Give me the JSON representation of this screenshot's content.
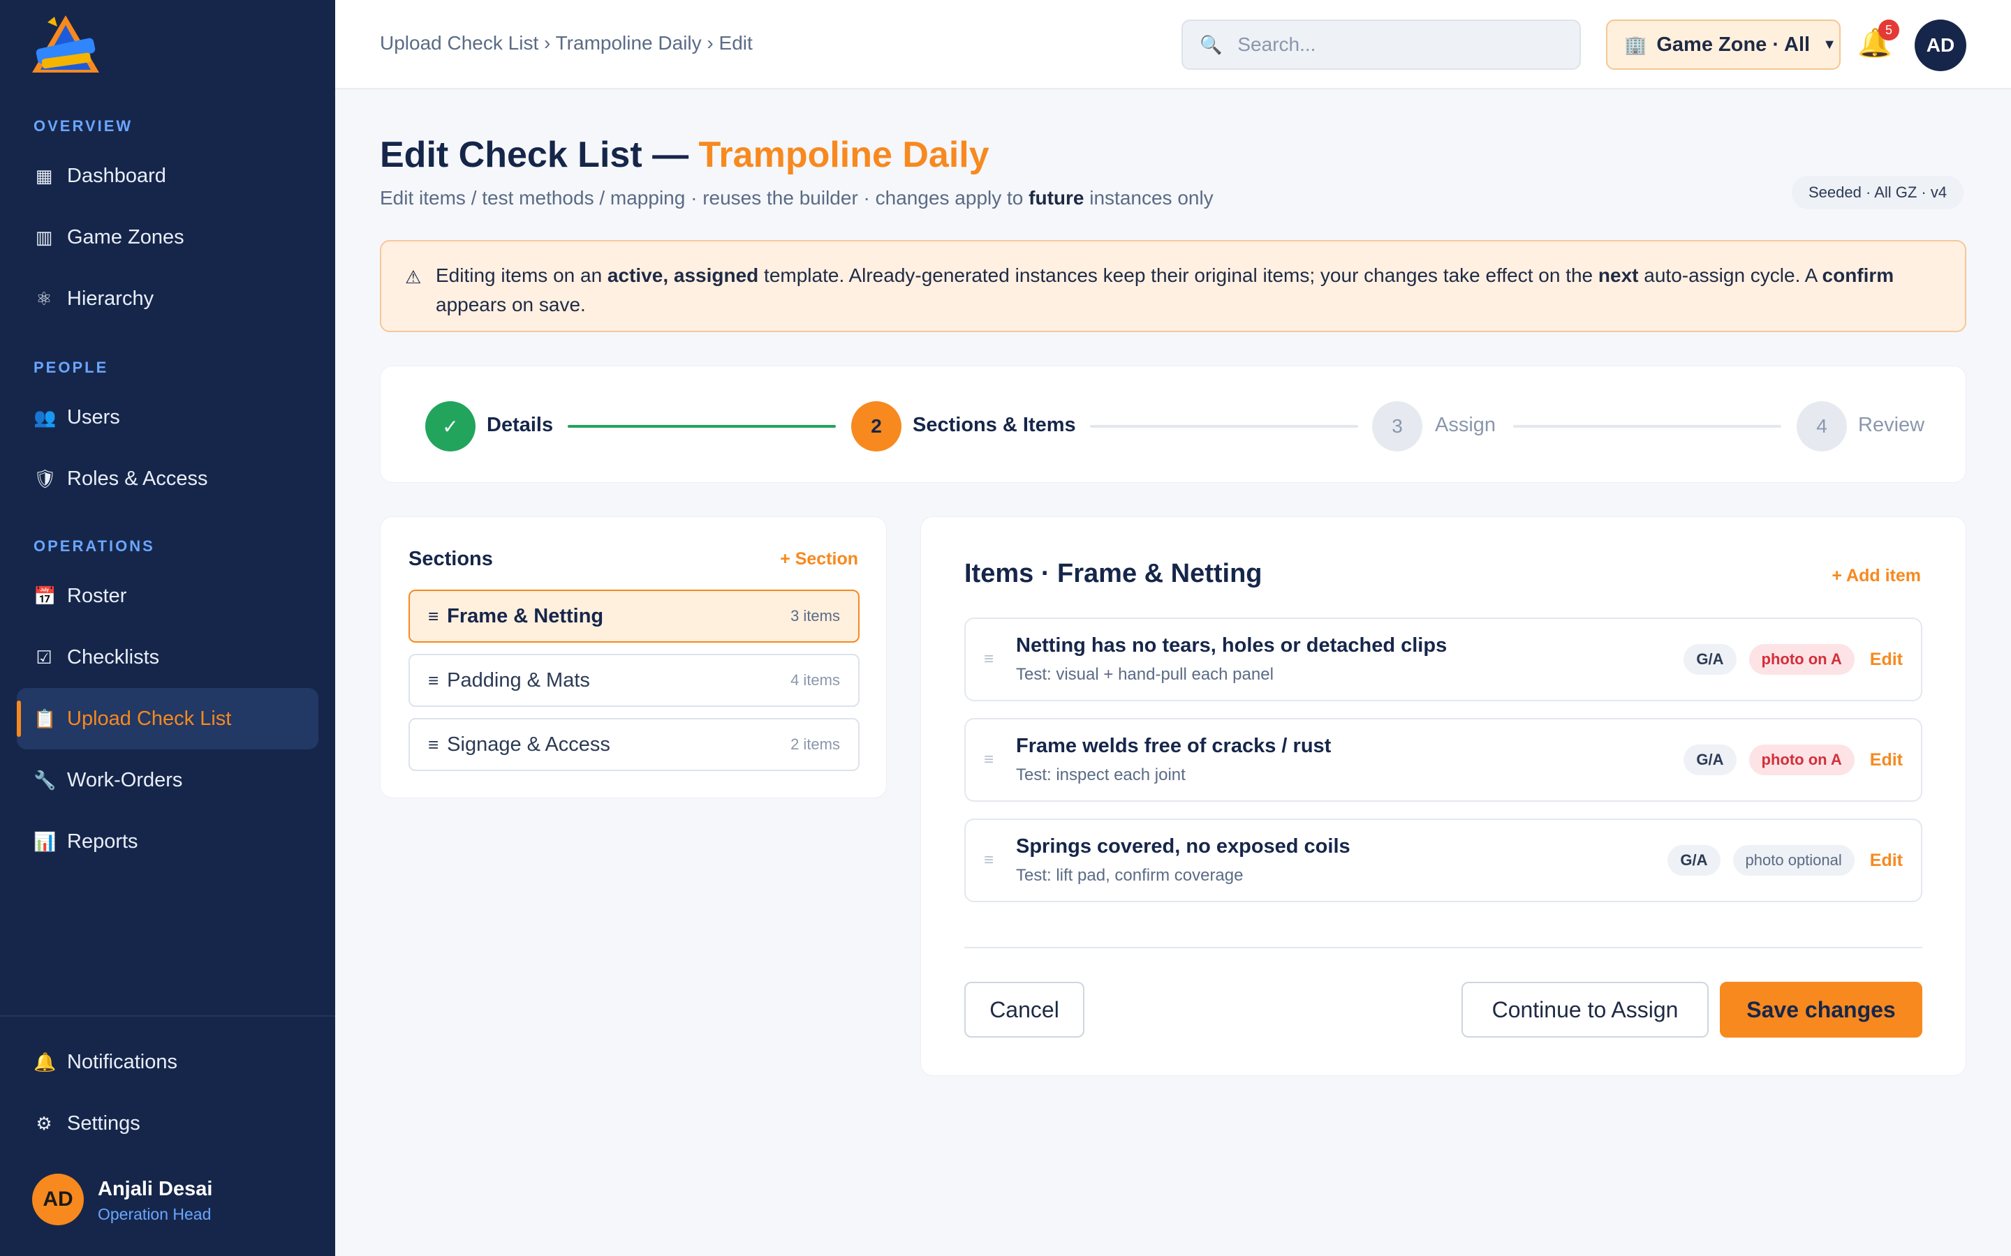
{
  "sidebar": {
    "groups": [
      {
        "title": "OVERVIEW",
        "items": [
          {
            "label": "Dashboard",
            "icon": "dashboard-icon"
          },
          {
            "label": "Game Zones",
            "icon": "building-icon"
          },
          {
            "label": "Hierarchy",
            "icon": "hierarchy-icon"
          }
        ]
      },
      {
        "title": "PEOPLE",
        "items": [
          {
            "label": "Users",
            "icon": "users-icon"
          },
          {
            "label": "Roles & Access",
            "icon": "shield-icon"
          }
        ]
      },
      {
        "title": "OPERATIONS",
        "items": [
          {
            "label": "Roster",
            "icon": "calendar-icon"
          },
          {
            "label": "Checklists",
            "icon": "checkbox-icon"
          },
          {
            "label": "Upload Check List",
            "icon": "clipboard-icon",
            "active": true
          },
          {
            "label": "Work-Orders",
            "icon": "wrench-icon"
          },
          {
            "label": "Reports",
            "icon": "bar-chart-icon"
          }
        ]
      }
    ],
    "bottom": [
      {
        "label": "Notifications",
        "icon": "bell-icon"
      },
      {
        "label": "Settings",
        "icon": "gear-icon"
      }
    ],
    "user": {
      "initials": "AD",
      "name": "Anjali Desai",
      "role": "Operation Head"
    }
  },
  "topbar": {
    "breadcrumb": "Upload Check List › Trampoline Daily › Edit",
    "search_placeholder": "Search...",
    "zone_selector": "Game Zone · All",
    "notification_count": "5",
    "avatar_initials": "AD"
  },
  "header": {
    "title_prefix": "Edit Check List — ",
    "title_accent": "Trampoline Daily",
    "subtitle_before": "Edit items / test methods / mapping · reuses the builder · changes apply to ",
    "subtitle_bold": "future",
    "subtitle_after": " instances only",
    "version_pill": "Seeded · All GZ · v4"
  },
  "warning": {
    "t1": "Editing items on an ",
    "b1": "active, assigned",
    "t2": " template. Already-generated instances keep their original items; your changes take effect on the ",
    "b2": "next",
    "t3": " auto-assign cycle. A ",
    "b3": "confirm",
    "t4": " appears on save."
  },
  "stepper": {
    "steps": [
      {
        "marker": "✓",
        "label": "Details",
        "state": "done"
      },
      {
        "marker": "2",
        "label": "Sections & Items",
        "state": "current"
      },
      {
        "marker": "3",
        "label": "Assign",
        "state": "upcoming"
      },
      {
        "marker": "4",
        "label": "Review",
        "state": "upcoming"
      }
    ]
  },
  "sections": {
    "title": "Sections",
    "add_label": "+ Section",
    "list": [
      {
        "label": "Frame & Netting",
        "count": "3 items",
        "active": true
      },
      {
        "label": "Padding & Mats",
        "count": "4 items"
      },
      {
        "label": "Signage & Access",
        "count": "2 items"
      }
    ]
  },
  "items": {
    "title": "Items · Frame & Netting",
    "add_label": "+ Add item",
    "list": [
      {
        "title": "Netting has no tears, holes or detached clips",
        "test": "Test: visual + hand-pull each panel",
        "code": "G/A",
        "photo": "photo on A",
        "photo_kind": "required",
        "edit": "Edit"
      },
      {
        "title": "Frame welds free of cracks / rust",
        "test": "Test: inspect each joint",
        "code": "G/A",
        "photo": "photo on A",
        "photo_kind": "required",
        "edit": "Edit"
      },
      {
        "title": "Springs covered, no exposed coils",
        "test": "Test: lift pad, confirm coverage",
        "code": "G/A",
        "photo": "photo optional",
        "photo_kind": "optional",
        "edit": "Edit"
      }
    ],
    "buttons": {
      "cancel": "Cancel",
      "continue": "Continue to Assign",
      "save": "Save changes"
    }
  },
  "colors": {
    "accent": "#f7891f",
    "sidebar": "#16264a",
    "success": "#22a45d",
    "danger": "#d32f3a"
  }
}
